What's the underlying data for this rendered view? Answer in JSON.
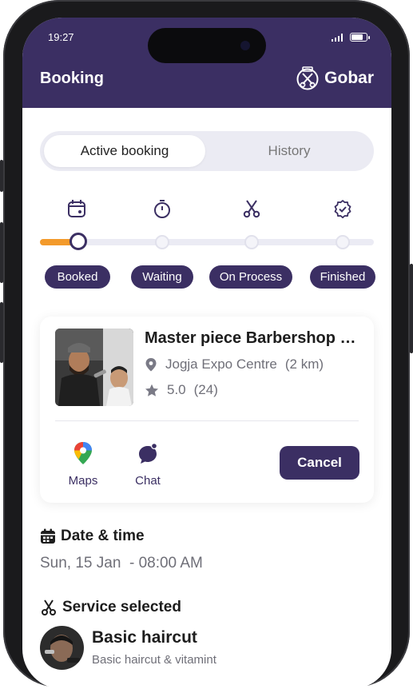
{
  "status_bar": {
    "time": "19:27"
  },
  "header": {
    "title": "Booking",
    "brand": "Gobar"
  },
  "tabs": [
    {
      "label": "Active booking",
      "active": true
    },
    {
      "label": "History",
      "active": false
    }
  ],
  "progress": {
    "current_step": 1,
    "steps": [
      {
        "label": "Booked",
        "icon": "calendar-icon"
      },
      {
        "label": "Waiting",
        "icon": "timer-icon"
      },
      {
        "label": "On Process",
        "icon": "scissors-icon"
      },
      {
        "label": "Finished",
        "icon": "check-badge-icon"
      }
    ]
  },
  "booking_card": {
    "shop_name": "Master piece Barbershop Jogja",
    "location": "Jogja Expo Centre",
    "distance": "(2 km)",
    "rating": "5.0",
    "reviews": "(24)",
    "actions": {
      "maps": "Maps",
      "chat": "Chat",
      "cancel": "Cancel"
    }
  },
  "date_time": {
    "title": "Date & time",
    "value": "Sun, 15 Jan  - 08:00 AM"
  },
  "service": {
    "title": "Service selected",
    "name": "Basic haircut",
    "description": "Basic haircut & vitamint"
  },
  "colors": {
    "primary": "#3b2f63",
    "accent": "#f39a2b",
    "muted": "#6f6f78"
  }
}
